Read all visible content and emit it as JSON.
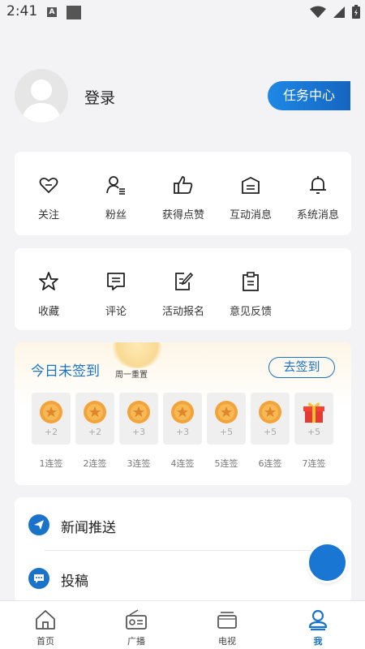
{
  "status_bar": {
    "time": "2:41",
    "a_badge": "A"
  },
  "profile": {
    "login_label": "登录",
    "task_center_label": "任务中心"
  },
  "quick_menu_1": [
    {
      "label": "关注",
      "icon": "heart-icon"
    },
    {
      "label": "粉丝",
      "icon": "user-list-icon"
    },
    {
      "label": "获得点赞",
      "icon": "thumbs-up-icon"
    },
    {
      "label": "互动消息",
      "icon": "interaction-message-icon"
    },
    {
      "label": "系统消息",
      "icon": "bell-icon"
    }
  ],
  "quick_menu_2": [
    {
      "label": "收藏",
      "icon": "star-icon"
    },
    {
      "label": "评论",
      "icon": "comment-icon"
    },
    {
      "label": "活动报名",
      "icon": "edit-form-icon"
    },
    {
      "label": "意见反馈",
      "icon": "clipboard-icon"
    }
  ],
  "signin": {
    "title": "今日未签到",
    "subtitle": "周一重置",
    "button_label": "去签到",
    "days": [
      {
        "points": "+2",
        "label": "1连签",
        "reward": "coin"
      },
      {
        "points": "+2",
        "label": "2连签",
        "reward": "coin"
      },
      {
        "points": "+3",
        "label": "3连签",
        "reward": "coin"
      },
      {
        "points": "+3",
        "label": "4连签",
        "reward": "coin"
      },
      {
        "points": "+5",
        "label": "5连签",
        "reward": "coin"
      },
      {
        "points": "+5",
        "label": "6连签",
        "reward": "coin"
      },
      {
        "points": "+5",
        "label": "7连签",
        "reward": "gift"
      }
    ]
  },
  "list": [
    {
      "label": "新闻推送",
      "icon": "paper-plane-icon"
    },
    {
      "label": "投稿",
      "icon": "chat-bubble-icon"
    }
  ],
  "tabs": [
    {
      "label": "首页",
      "icon": "home-icon",
      "active": false
    },
    {
      "label": "广播",
      "icon": "radio-icon",
      "active": false
    },
    {
      "label": "电视",
      "icon": "tv-icon",
      "active": false
    },
    {
      "label": "我",
      "icon": "user-icon",
      "active": true
    }
  ],
  "colors": {
    "accent": "#1a73c9",
    "background": "#f3f3f5",
    "coin": "#f2a33a",
    "gift": "#e53935"
  }
}
